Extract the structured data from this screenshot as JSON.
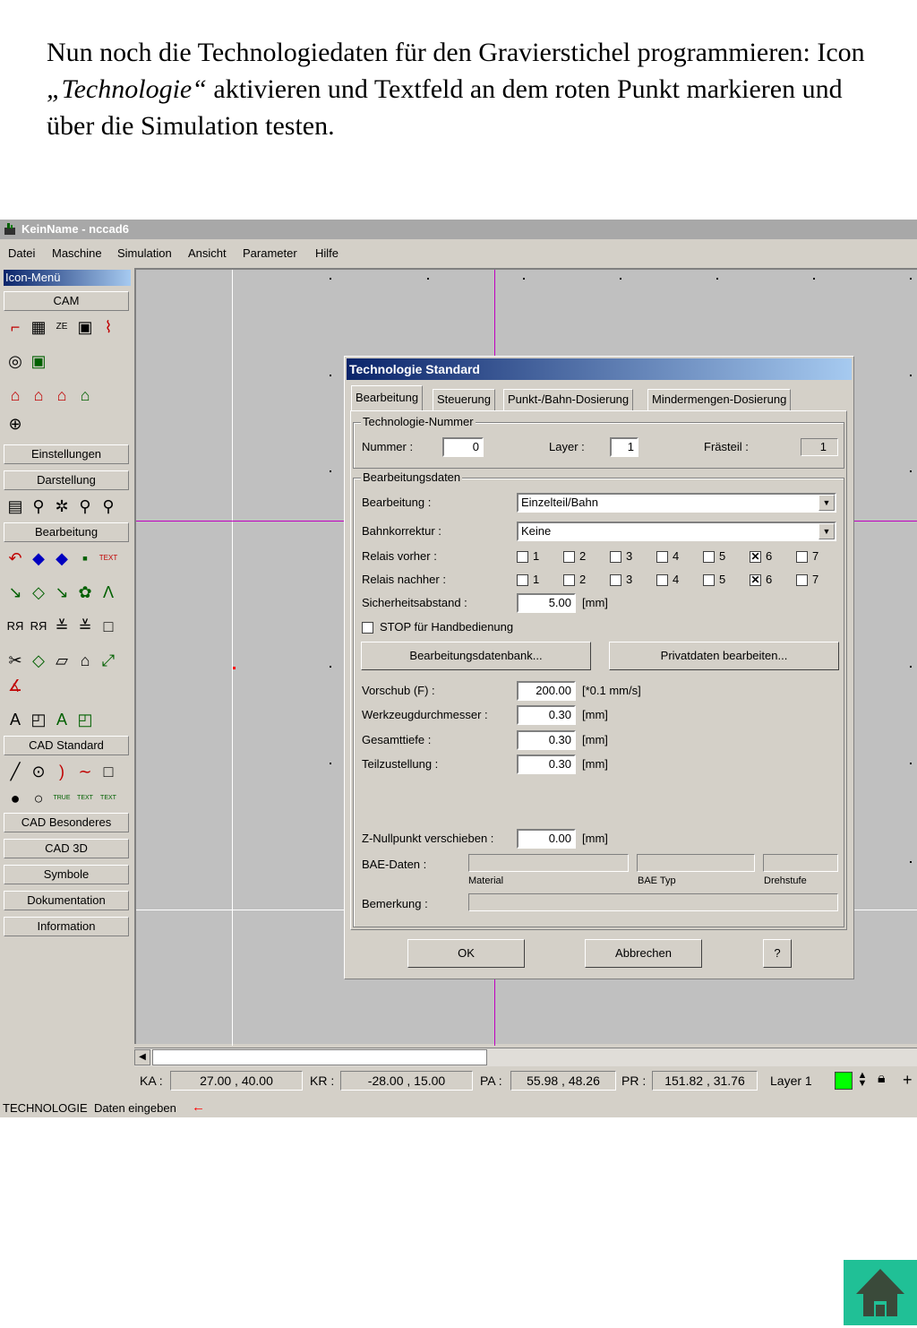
{
  "intro": {
    "part1": "Nun noch die Technologiedaten für den Gravierstichel programmieren: Icon ",
    "italic": "„Technologie“",
    "part2": " aktivieren und Textfeld an dem roten Punkt markieren und über die Simulation testen."
  },
  "window": {
    "title": "KeinName - nccad6"
  },
  "menu": [
    "Datei",
    "Maschine",
    "Simulation",
    "Ansicht",
    "Parameter",
    "Hilfe"
  ],
  "leftpanel": {
    "title": "Icon-Menü",
    "sections": [
      "CAM",
      "Einstellungen",
      "Darstellung",
      "Bearbeitung",
      "CAD Standard",
      "CAD Besonderes",
      "CAD 3D",
      "Symbole",
      "Dokumentation",
      "Information"
    ],
    "text_icon_label": "TEXT",
    "true_label": "TRUE"
  },
  "coords": {
    "ka_label": "KA :",
    "ka": "27.00 ,  40.00",
    "kr_label": "KR :",
    "kr": "-28.00 ,  15.00",
    "pa_label": "PA :",
    "pa": "55.98 ,  48.26",
    "pr_label": "PR :",
    "pr": "151.82 ,  31.76",
    "layer": "Layer 1"
  },
  "status": {
    "mode": "TECHNOLOGIE",
    "hint": "Daten eingeben"
  },
  "dialog": {
    "title": "Technologie Standard",
    "tabs": [
      "Bearbeitung",
      "Steuerung",
      "Punkt-/Bahn-Dosierung",
      "Mindermengen-Dosierung"
    ],
    "tech_group": "Technologie-Nummer",
    "nummer_label": "Nummer :",
    "nummer": "0",
    "layer_label": "Layer :",
    "layer": "1",
    "fraesteil_label": "Frästeil :",
    "fraesteil": "1",
    "data_group": "Bearbeitungsdaten",
    "bearbeitung_label": "Bearbeitung :",
    "bearbeitung": "Einzelteil/Bahn",
    "bahnkorrektur_label": "Bahnkorrektur :",
    "bahnkorrektur": "Keine",
    "relais_vorher_label": "Relais vorher :",
    "relais_nachher_label": "Relais nachher :",
    "relais_numbers": [
      "1",
      "2",
      "3",
      "4",
      "5",
      "6",
      "7"
    ],
    "relais_checked": "6",
    "sicherheit_label": "Sicherheitsabstand :",
    "sicherheit": "5.00",
    "unit_mm": "[mm]",
    "stop_label": "STOP für Handbedienung",
    "btn_datenbank": "Bearbeitungsdatenbank...",
    "btn_privat": "Privatdaten bearbeiten...",
    "vorschub_label": "Vorschub (F) :",
    "vorschub": "200.00",
    "vorschub_unit": "[*0.1 mm/s]",
    "werkzeug_label": "Werkzeugdurchmesser :",
    "werkzeug": "0.30",
    "gesamttiefe_label": "Gesamttiefe :",
    "gesamttiefe": "0.30",
    "teilzustellung_label": "Teilzustellung :",
    "teilzustellung": "0.30",
    "znull_label": "Z-Nullpunkt verschieben :",
    "znull": "0.00",
    "bae_label": "BAE-Daten :",
    "material_label": "Material",
    "baetyp_label": "BAE Typ",
    "drehstufe_label": "Drehstufe",
    "bemerkung_label": "Bemerkung :",
    "ok": "OK",
    "abbrechen": "Abbrechen",
    "help": "?"
  }
}
